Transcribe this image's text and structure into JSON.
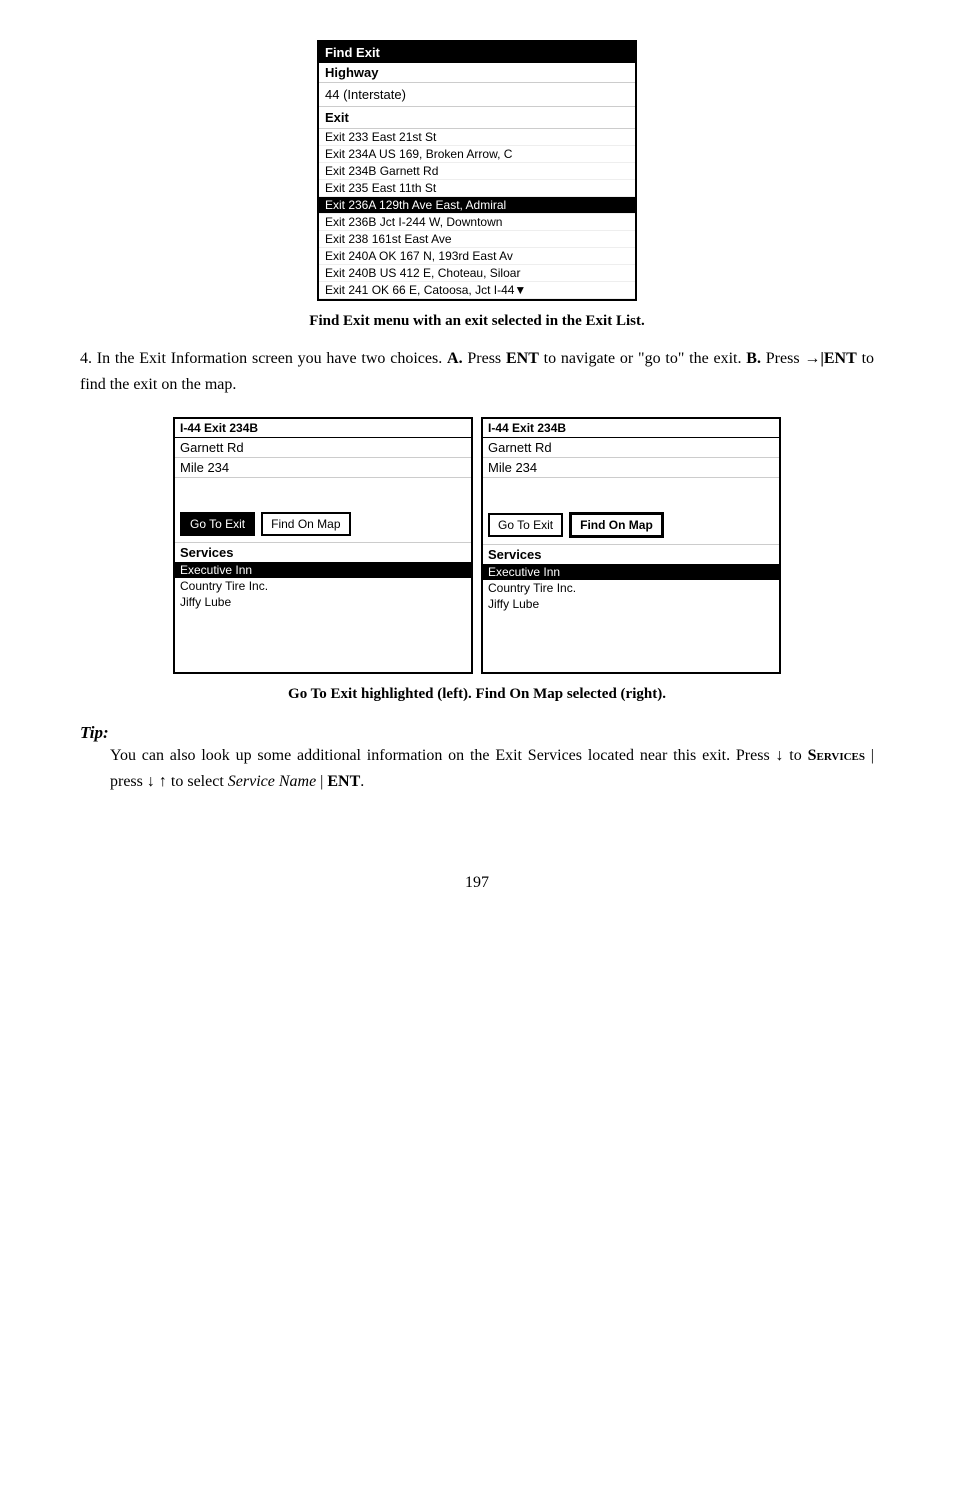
{
  "page": {
    "number": "197"
  },
  "find_exit_screen": {
    "title": "Find Exit",
    "highway_label": "Highway",
    "highway_value": "44 (Interstate)",
    "exit_label": "Exit",
    "exits": [
      {
        "text": "Exit 233 East 21st St",
        "highlighted": false
      },
      {
        "text": "Exit 234A US 169, Broken Arrow, C",
        "highlighted": false
      },
      {
        "text": "Exit 234B Garnett Rd",
        "highlighted": false
      },
      {
        "text": "Exit 235 East 11th St",
        "highlighted": false
      },
      {
        "text": "Exit 236A 129th Ave East, Admiral",
        "highlighted": true
      },
      {
        "text": "Exit 236B Jct I-244 W, Downtown",
        "highlighted": false
      },
      {
        "text": "Exit 238 161st East Ave",
        "highlighted": false
      },
      {
        "text": "Exit 240A OK 167 N, 193rd East Av",
        "highlighted": false
      },
      {
        "text": "Exit 240B US 412 E, Choteau, Siloar",
        "highlighted": false
      },
      {
        "text": "Exit 241 OK 66 E, Catoosa, Jct I-44",
        "highlighted": false
      }
    ]
  },
  "screenshot_caption": "Find Exit menu with an exit selected in the Exit List.",
  "body_text": {
    "part1": "4. In the Exit Information screen you have two choices. ",
    "a_label": "A.",
    "a_text": " Press ",
    "ent1": "ENT",
    "a_text2": " to navigate or \"go to\" the exit. ",
    "b_label": "B.",
    "b_text": " Press ",
    "arrow_ent": "→|ENT",
    "b_text2": " to find the exit on the map."
  },
  "left_panel": {
    "title": "I-44 Exit 234B",
    "road": "Garnett Rd",
    "mile": "Mile 234",
    "go_to_exit_label": "Go To Exit",
    "find_on_map_label": "Find On Map",
    "go_highlighted": true,
    "find_selected": false,
    "services_label": "Services",
    "services": [
      {
        "name": "Executive Inn",
        "highlighted": true
      },
      {
        "name": "Country Tire Inc.",
        "highlighted": false
      },
      {
        "name": "Jiffy Lube",
        "highlighted": false
      }
    ]
  },
  "right_panel": {
    "title": "I-44 Exit 234B",
    "road": "Garnett Rd",
    "mile": "Mile 234",
    "go_to_exit_label": "Go To Exit",
    "find_on_map_label": "Find On Map",
    "go_highlighted": false,
    "find_selected": true,
    "services_label": "Services",
    "services": [
      {
        "name": "Executive Inn",
        "highlighted": true
      },
      {
        "name": "Country Tire Inc.",
        "highlighted": false
      },
      {
        "name": "Jiffy Lube",
        "highlighted": false
      }
    ]
  },
  "panels_caption": "Go To Exit highlighted (left). Find On Map selected (right).",
  "tip": {
    "label": "Tip:",
    "text_part1": "You can also look up some additional information on the Exit Services located near this exit. Press ",
    "down_arrow": "↓",
    "services_bold": "Services",
    "text_part2": " | press ",
    "arrows": "↓ ↑",
    "text_part3": " to select ",
    "service_name_italic": "Service Name",
    "separator": " | ",
    "ent_bold": "ENT",
    "period": "."
  }
}
